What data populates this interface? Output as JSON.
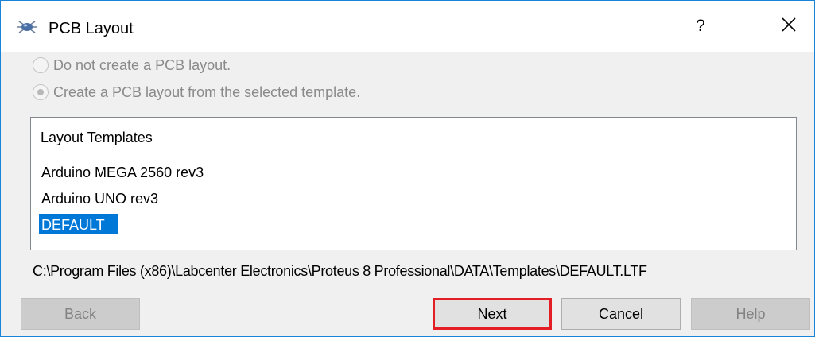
{
  "window": {
    "title": "PCB Layout",
    "help_label": "?",
    "close_label": "✕"
  },
  "options": {
    "no_layout": {
      "label": "Do not create a PCB layout.",
      "checked": false,
      "enabled": false
    },
    "from_template": {
      "label": "Create a PCB layout from the selected template.",
      "checked": true,
      "enabled": false
    }
  },
  "templates": {
    "header": "Layout Templates",
    "items": [
      {
        "label": "Arduino MEGA 2560 rev3",
        "selected": false
      },
      {
        "label": "Arduino UNO rev3",
        "selected": false
      },
      {
        "label": "DEFAULT",
        "selected": true
      }
    ]
  },
  "path": "C:\\Program Files (x86)\\Labcenter Electronics\\Proteus 8 Professional\\DATA\\Templates\\DEFAULT.LTF",
  "buttons": {
    "back": {
      "label": "Back",
      "enabled": false
    },
    "next": {
      "label": "Next",
      "enabled": true
    },
    "cancel": {
      "label": "Cancel",
      "enabled": true
    },
    "help": {
      "label": "Help",
      "enabled": false
    }
  },
  "colors": {
    "selection": "#0078d7",
    "focus_highlight": "#e31e24",
    "window_border": "#1883d7"
  }
}
